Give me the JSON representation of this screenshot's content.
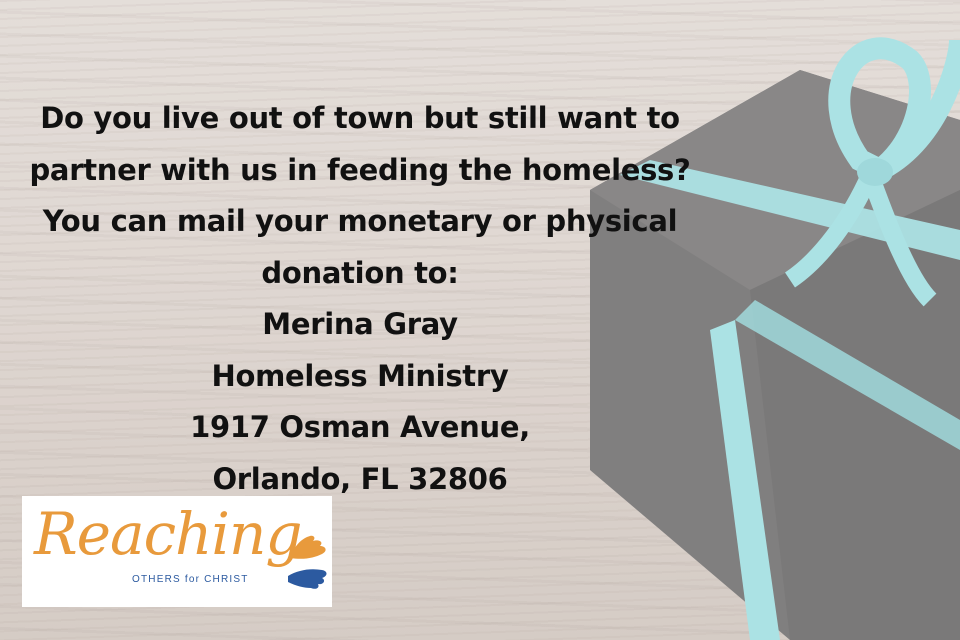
{
  "message": {
    "lines": [
      "Do you live out of town but still want to",
      "partner with us in feeding the homeless?",
      "You can mail your monetary or physical",
      "donation to:",
      "Merina Gray",
      "Homeless Ministry",
      "1917 Osman Avenue,",
      "Orlando, FL 32806"
    ]
  },
  "logo": {
    "word": "Reaching",
    "tagline": "OTHERS for CHRIST"
  },
  "colors": {
    "text": "#111111",
    "logo_orange": "#e89a3c",
    "logo_blue": "#2c5aa0",
    "ribbon": "#7fd3d6",
    "box": "#3a3838"
  }
}
